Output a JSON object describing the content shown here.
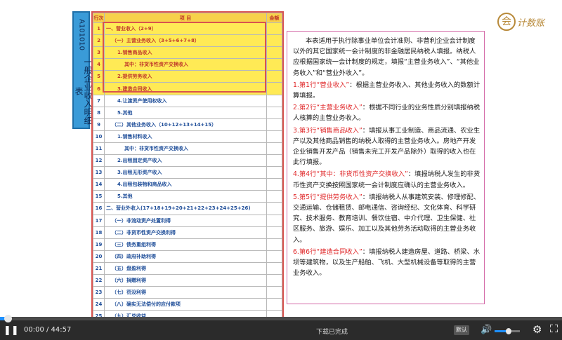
{
  "sidebar_title": {
    "code": "A101010",
    "name": "一般企业收入明细表"
  },
  "form": {
    "headers": [
      "行次",
      "项        目",
      "金额"
    ],
    "rows": [
      {
        "no": "1",
        "item": "一、营业收入（2+9）",
        "hl": true,
        "indent": 0
      },
      {
        "no": "2",
        "item": "（一）主营业务收入（3+5+6+7+8）",
        "hl": true,
        "indent": 1
      },
      {
        "no": "3",
        "item": "1.销售商品收入",
        "hl": true,
        "indent": 2
      },
      {
        "no": "4",
        "item": "其中：非货币性资产交换收入",
        "hl": true,
        "indent": 3
      },
      {
        "no": "5",
        "item": "2.提供劳务收入",
        "hl": true,
        "indent": 2
      },
      {
        "no": "6",
        "item": "3.建造合同收入",
        "hl": true,
        "indent": 2
      },
      {
        "no": "7",
        "item": "4.让渡资产使用权收入",
        "hl": false,
        "indent": 2
      },
      {
        "no": "8",
        "item": "5.其他",
        "hl": false,
        "indent": 2
      },
      {
        "no": "9",
        "item": "（二）其他业务收入（10+12+13+14+15）",
        "hl": false,
        "indent": 1
      },
      {
        "no": "10",
        "item": "1.销售材料收入",
        "hl": false,
        "indent": 2
      },
      {
        "no": "11",
        "item": "其中：非货币性资产交换收入",
        "hl": false,
        "indent": 3
      },
      {
        "no": "12",
        "item": "2.出租固定资产收入",
        "hl": false,
        "indent": 2
      },
      {
        "no": "13",
        "item": "3.出租无形资产收入",
        "hl": false,
        "indent": 2
      },
      {
        "no": "14",
        "item": "4.出租包装物和商品收入",
        "hl": false,
        "indent": 2
      },
      {
        "no": "15",
        "item": "5.其他",
        "hl": false,
        "indent": 2
      },
      {
        "no": "16",
        "item": "二、营业外收入(17+18+19+20+21+22+23+24+25+26)",
        "hl": false,
        "indent": 0
      },
      {
        "no": "17",
        "item": "（一）非流动资产处置利得",
        "hl": false,
        "indent": 1
      },
      {
        "no": "18",
        "item": "（二）非货币性资产交换利得",
        "hl": false,
        "indent": 1
      },
      {
        "no": "19",
        "item": "（三）债务重组利得",
        "hl": false,
        "indent": 1
      },
      {
        "no": "20",
        "item": "（四）政府补助利得",
        "hl": false,
        "indent": 1
      },
      {
        "no": "21",
        "item": "（五）盘盈利得",
        "hl": false,
        "indent": 1
      },
      {
        "no": "22",
        "item": "（六）捐赠利得",
        "hl": false,
        "indent": 1
      },
      {
        "no": "23",
        "item": "（七）罚没利得",
        "hl": false,
        "indent": 1
      },
      {
        "no": "24",
        "item": "（八）确实无法偿付的应付款项",
        "hl": false,
        "indent": 1
      },
      {
        "no": "25",
        "item": "（九）汇兑收益",
        "hl": false,
        "indent": 1
      },
      {
        "no": "26",
        "item": "（十）其他",
        "hl": false,
        "indent": 1
      }
    ]
  },
  "notes": [
    {
      "title": "",
      "body": "本表适用于执行除事业单位会计准则、非营利企业会计制度以外的其它国家统一会计制度的非金融居民纳税人填报。纳税人应根据国家统一会计制度的规定，填报“主营业务收入”、“其他业务收入”和“营业外收入”。"
    },
    {
      "title": "1.第1行“营业收入”",
      "body": "：根据主营业务收入、其他业务收入的数额计算填报。"
    },
    {
      "title": "2.第2行“主营业务收入”",
      "body": "：根据不同行业的业务性质分别填报纳税人核算的主营业务收入。"
    },
    {
      "title": "3.第3行“销售商品收入”",
      "body": "：填报从事工业制造、商品流通、农业生产以及其他商品销售的纳税人取得的主营业务收入。房地产开发企业销售开发产品（销售未完工开发产品除外）取得的收入也在此行填报。"
    },
    {
      "title": "4.第4行“其中：非货币性资产交换收入”",
      "body": "：填报纳税人发生的非货币性资产交换按照国家统一会计制度应确认的主营业务收入。"
    },
    {
      "title": "5.第5行“提供劳务收入”",
      "body": "：填报纳税人从事建筑安装、修理修配、交通运输、仓储租赁、邮电通信、咨询经纪、文化体育、科学研究、技术服务、教育培训、餐饮住宿、中介代理、卫生保健、社区服务、旅游、娱乐、加工以及其他劳务活动取得的主营业务收入。"
    },
    {
      "title": "6.第6行“建造合同收入”",
      "body": "：填报纳税人建造房屋、道路、桥梁、水坝等建筑物，以及生产船舶、飞机、大型机械设备等取得的主营业务收入。"
    }
  ],
  "logo": {
    "mark": "会",
    "text": "计数账"
  },
  "player": {
    "time": "00:00 / 44:57",
    "status": "下载已完成",
    "quality": "默认",
    "progress": 0.01,
    "volume": 0.55,
    "icons": {
      "play": "pause-icon",
      "volume": "speaker-icon",
      "settings": "gear-icon",
      "fullscreen": "fullscreen-icon"
    }
  }
}
